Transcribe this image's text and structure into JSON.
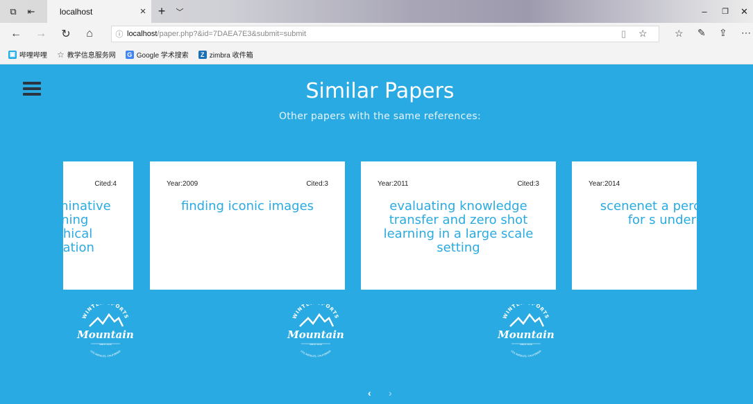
{
  "browser": {
    "tab_title": "localhost",
    "url_host": "localhost",
    "url_path": "/paper.php?&id=7DAEA7E3&submit=submit",
    "favorites": [
      {
        "label": "哔哩哔哩",
        "icon": "bilibili-icon",
        "color": "#23ade5"
      },
      {
        "label": "教学信息服务网",
        "icon": "star-icon",
        "color": "#555555"
      },
      {
        "label": "Google 学术搜索",
        "icon": "google-scholar-icon",
        "color": "#4285f4"
      },
      {
        "label": "zimbra 收件箱",
        "icon": "zimbra-icon",
        "color": "#1a6fb5"
      }
    ]
  },
  "page": {
    "title": "Similar Papers",
    "subtitle": "Other papers with the same references:",
    "background": "#2aaae2"
  },
  "cards": [
    {
      "year": "",
      "cited": "Cited:4",
      "title": "minative\nrning\nchical\nzation"
    },
    {
      "year": "Year:2009",
      "cited": "Cited:3",
      "title": "finding iconic images"
    },
    {
      "year": "Year:2011",
      "cited": "Cited:3",
      "title": "evaluating knowledge transfer and zero shot learning in a large scale setting"
    },
    {
      "year": "Year:2014",
      "cited": "",
      "title": "scenenet a perc ontology for s understand"
    }
  ],
  "logo": {
    "top_text": "WINTER SPORTS",
    "main_text": "Mountain",
    "year_text": "SINCE 2016",
    "bottom_text": "LOS ANGELES, CALIFORNIA"
  },
  "carousel": {
    "prev": "‹",
    "next": "›"
  }
}
